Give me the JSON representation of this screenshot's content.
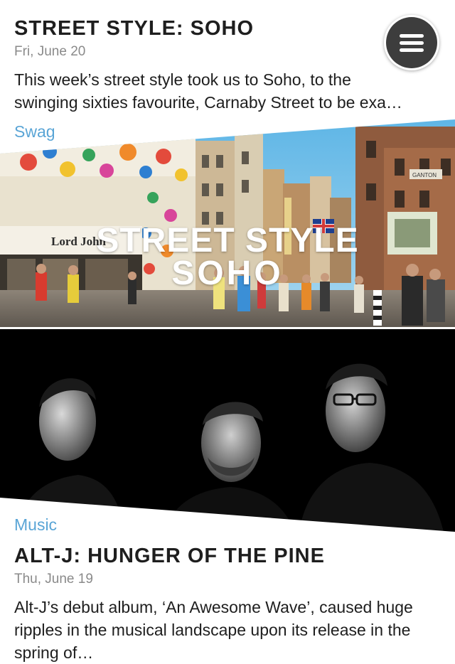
{
  "menu": {
    "icon": "hamburger-menu-icon"
  },
  "articles": [
    {
      "title": "STREET STYLE: SOHO",
      "date": "Fri, June 20",
      "excerpt": "This week’s street style took us to Soho, to the swinging sixties favourite, Carnaby Street to be exa…",
      "category": "Swag",
      "image": {
        "caption_line1": "STREET STYLE",
        "caption_line2": "SOHO",
        "shop_sign": "Lord John",
        "sign_right": "GANTON"
      }
    },
    {
      "title": "ALT-J: HUNGER OF THE PINE",
      "date": "Thu, June 19",
      "excerpt": "Alt-J’s debut album, ‘An Awesome Wave’, caused huge ripples in the musical landscape upon its release in the spring of…",
      "category": "Music"
    }
  ],
  "colors": {
    "category": "#5aa5d6",
    "menu_button": "#3d3d3d",
    "date": "#8a8a8a"
  }
}
